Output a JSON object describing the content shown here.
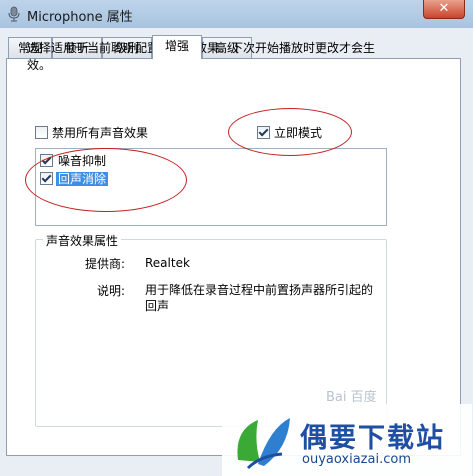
{
  "window": {
    "title": "Microphone 属性",
    "close_label": "✕"
  },
  "tabs": [
    {
      "label": "常规"
    },
    {
      "label": "侦听"
    },
    {
      "label": "级别"
    },
    {
      "label": "增强",
      "active": true
    },
    {
      "label": "高级"
    }
  ],
  "enhance": {
    "description": "选择适用于当前聆听配置的声音效果。下次开始播放时更改才会生效。",
    "disable_all": {
      "label": "禁用所有声音效果",
      "checked": false
    },
    "immediate_mode": {
      "label": "立即模式",
      "checked": true
    },
    "effects": [
      {
        "label": "噪音抑制",
        "checked": true,
        "selected": false
      },
      {
        "label": "回声消除",
        "checked": true,
        "selected": true
      }
    ],
    "properties": {
      "group_title": "声音效果属性",
      "provider_label": "提供商:",
      "provider_value": "Realtek",
      "description_label": "说明:",
      "description_value_line1": "用于降低在录音过程中前置扬声器所引起的",
      "description_value_line2": "回声"
    }
  },
  "watermark": {
    "brand": "偶要下载站",
    "url": "ouyaoxiazai.com",
    "baidu": "Bai 百度"
  },
  "colors": {
    "accent_selection": "#3d8ee6",
    "annotation_red": "#c62020",
    "brand_blue": "#1f4fa1",
    "brand_green": "#3aa935"
  }
}
